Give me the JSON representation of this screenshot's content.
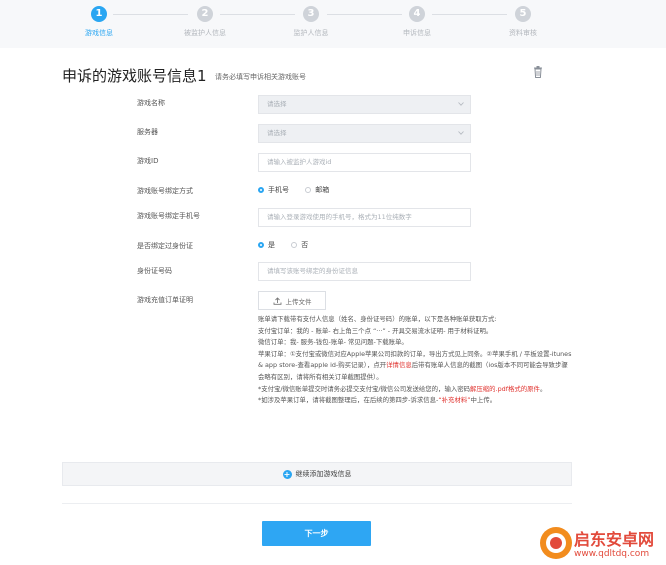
{
  "stepper": {
    "steps": [
      {
        "num": "1",
        "label": "游戏信息",
        "active": true
      },
      {
        "num": "2",
        "label": "被监护人信息",
        "active": false
      },
      {
        "num": "3",
        "label": "监护人信息",
        "active": false
      },
      {
        "num": "4",
        "label": "申诉信息",
        "active": false
      },
      {
        "num": "5",
        "label": "资料审核",
        "active": false
      }
    ]
  },
  "header": {
    "title": "申诉的游戏账号信息1",
    "subtitle": "请务必填写申诉相关游戏账号"
  },
  "form": {
    "game_name": {
      "label": "游戏名称",
      "value": "请选择"
    },
    "server": {
      "label": "服务器",
      "value": "请选择"
    },
    "game_id": {
      "label": "游戏ID",
      "placeholder": "请输入被监护人游戏id"
    },
    "bind_method": {
      "label": "游戏账号绑定方式",
      "options": [
        "手机号",
        "邮箱"
      ],
      "selected": "手机号"
    },
    "bind_phone": {
      "label": "游戏账号绑定手机号",
      "placeholder": "请输入登录游戏使用的手机号，格式为11位纯数字"
    },
    "id_bound": {
      "label": "是否绑定过身份证",
      "options": [
        "是",
        "否"
      ],
      "selected": "是"
    },
    "id_number": {
      "label": "身份证号码",
      "placeholder": "请填写该账号绑定的身份证信息"
    },
    "recharge_proof": {
      "label": "游戏充值订单证明",
      "upload_label": "上传文件"
    }
  },
  "notes": {
    "line1": "账单请下载带有支付人信息（姓名、身份证号码）的账单，以下是各种账单获取方式:",
    "line2": "支付宝订单：我的 - 账单- 右上角三个点 “···” - 开具交易流水证明- 用于材料证明。",
    "line3": "微信订单：我- 服务-钱包-账单- 常见问题-下载账单。",
    "line4": "苹果订单：①支付宝或微信对应Apple苹果公司扣款的订单，导出方式见上同条。②苹果手机 / 平板设置-itunes & app store-查看apple id-购买记录），点开",
    "line4_red": "详情信息",
    "line4_end": "后带有账单人信息的截图（ios版本不同可能会导致步骤会略有区别，请将所有相关订单截图提供）。",
    "line5": "*支付宝/微信账单提交时请务必提交支付宝/微信公司发送给您的，输入密码",
    "line5_red": "解压缩的.pdf格式的原件",
    "line5_end": "。",
    "line6": "*如涉及苹果订单，请将截图整理后，在后续的第四步-诉求信息-",
    "line6_red": "“补充材料”",
    "line6_end": "中上传。"
  },
  "add_more": {
    "label": "继续添加游戏信息"
  },
  "next_button": {
    "label": "下一步"
  },
  "watermark": {
    "text1": "启东安卓网",
    "text2": "www.qdltdq.com"
  }
}
